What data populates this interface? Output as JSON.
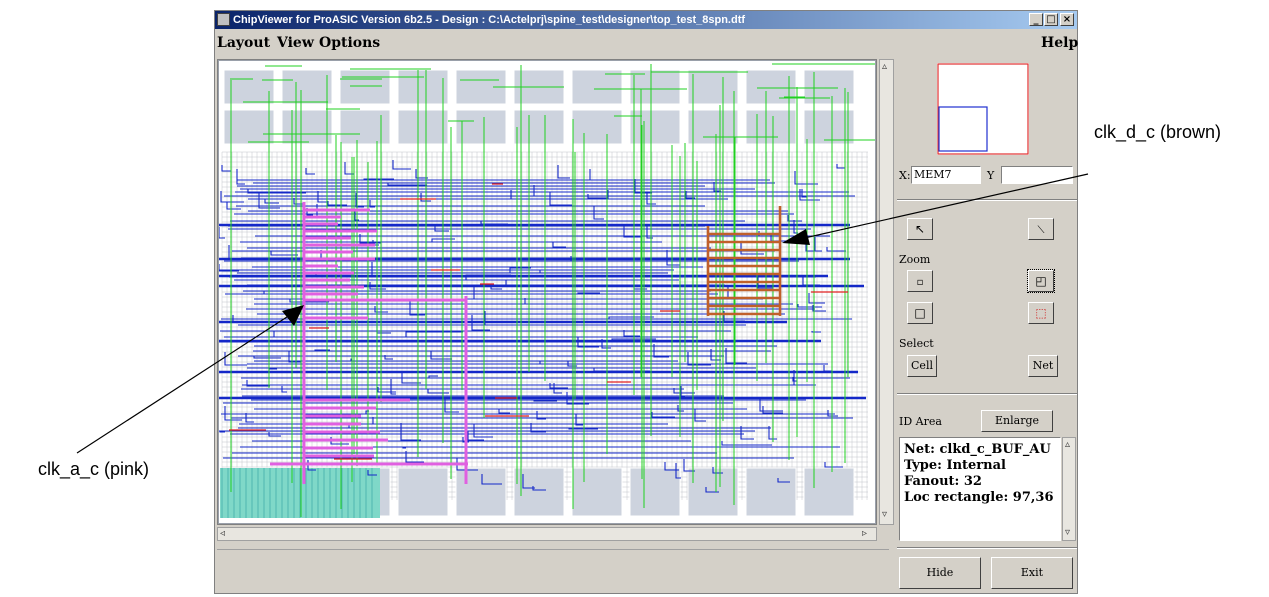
{
  "window": {
    "title": "ChipViewer for ProASIC  Version 6b2.5 - Design : C:\\Actelprj\\spine_test\\designer\\top_test_8spn.dtf",
    "controls": {
      "minimize": "_",
      "maximize": "□",
      "close": "×"
    }
  },
  "menubar": {
    "layout": "Layout",
    "view": "View",
    "options": "Options",
    "help": "Help"
  },
  "panel": {
    "x_label": "X:",
    "x_value": "MEM7",
    "y_label": "Y",
    "y_value": "",
    "zoom_label": "Zoom",
    "select_label": "Select",
    "cell_button": "Cell",
    "net_button": "Net",
    "id_area_label": "ID Area",
    "enlarge_button": "Enlarge",
    "info": {
      "net": "Net: clkd_c_BUF_AU",
      "type": "Type: Internal",
      "fanout": "Fanout: 32",
      "loc": "Loc rectangle: 97,36"
    },
    "hide_button": "Hide",
    "exit_button": "Exit"
  },
  "annotations": {
    "clk_d": "clk_d_c (brown)",
    "clk_a": "clk_a_c (pink)"
  },
  "colors": {
    "routing_blue": "#1428c8",
    "routing_green": "#20d020",
    "net_pink": "#e060e0",
    "net_brown": "#c0602a",
    "cell_fill": "#cdd3de",
    "grid_gray": "#b4b8c0",
    "title_start": "#0a246a",
    "title_end": "#a6caf0"
  }
}
